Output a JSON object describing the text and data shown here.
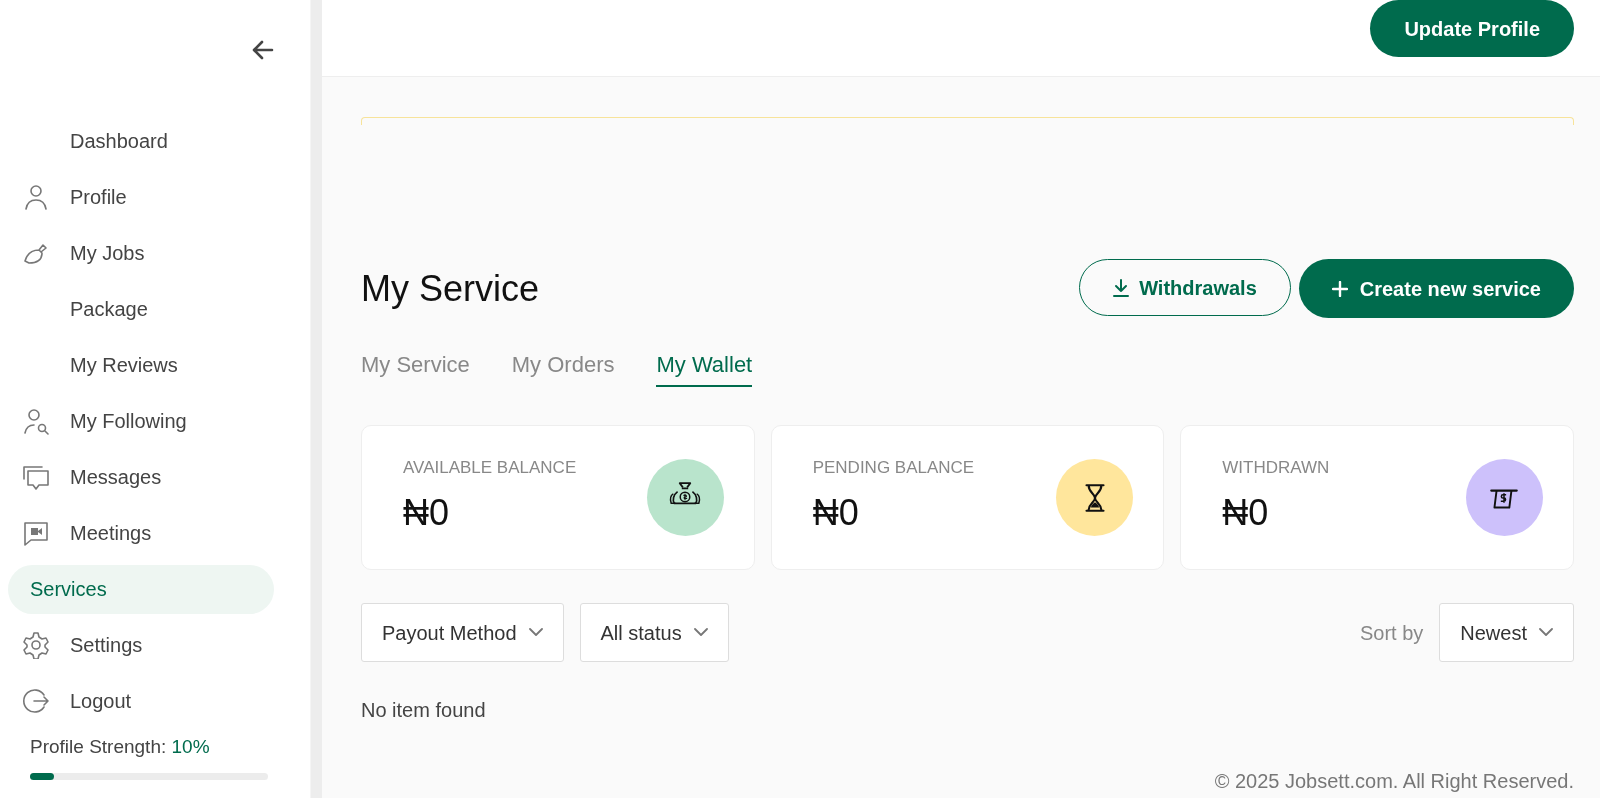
{
  "sidebar": {
    "items": [
      {
        "label": "Dashboard",
        "selected": false
      },
      {
        "label": "Profile",
        "selected": false
      },
      {
        "label": "My Jobs",
        "selected": false
      },
      {
        "label": "Package",
        "selected": false
      },
      {
        "label": "My Reviews",
        "selected": false
      },
      {
        "label": "My Following",
        "selected": false
      },
      {
        "label": "Messages",
        "selected": false
      },
      {
        "label": "Meetings",
        "selected": false
      },
      {
        "label": "Services",
        "selected": true
      },
      {
        "label": "Settings",
        "selected": false
      },
      {
        "label": "Logout",
        "selected": false
      }
    ],
    "profile_strength": {
      "label": "Profile Strength:",
      "value": "10%",
      "level": 0.1
    }
  },
  "header": {
    "button": "Update Profile"
  },
  "page": {
    "title": "My Service",
    "buttons": [
      {
        "label": "Withdrawals",
        "kind": "outline"
      },
      {
        "label": "Create new service",
        "kind": "solid"
      }
    ],
    "tabs": [
      {
        "label": "My Service",
        "selected": false
      },
      {
        "label": "My Orders",
        "selected": false
      },
      {
        "label": "My Wallet",
        "selected": true
      }
    ],
    "cards": [
      {
        "label": "AVAILABLE BALANCE",
        "amount": "₦0",
        "color": "#b9e4cc"
      },
      {
        "label": "PENDING BALANCE",
        "amount": "₦0",
        "color": "#ffe69c"
      },
      {
        "label": "WITHDRAWN",
        "amount": "₦0",
        "color": "#cdc1fb"
      }
    ],
    "filters": [
      "Payout Method",
      "All status"
    ],
    "sort": {
      "label": "Sort by",
      "value": "Newest"
    },
    "empty_text": "No item found"
  },
  "footer": "© 2025 Jobsett.com. All Right Reserved."
}
